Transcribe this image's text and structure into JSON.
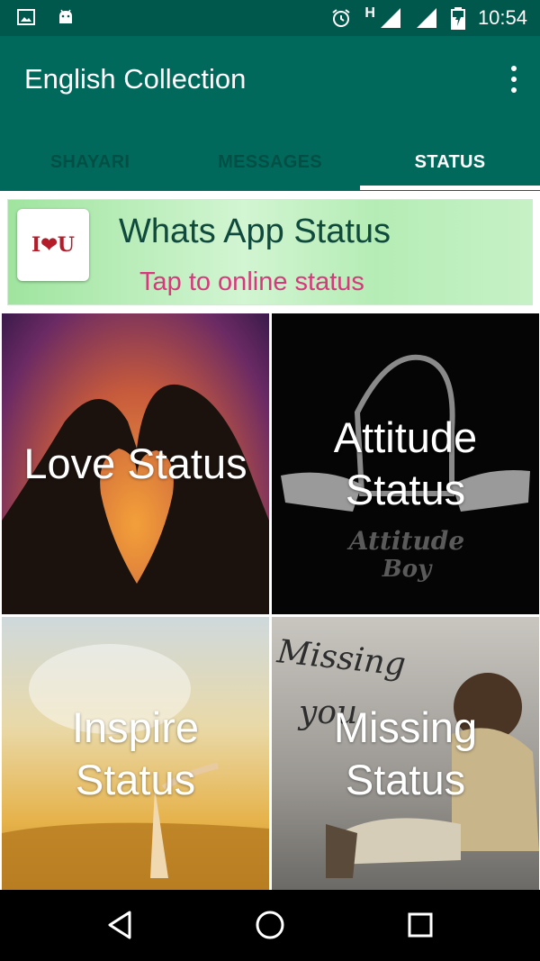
{
  "status_bar": {
    "time": "10:54",
    "network_letter": "H",
    "icons": [
      "gallery-icon",
      "android-icon",
      "alarm-icon",
      "signal-icon",
      "signal-icon",
      "battery-icon"
    ],
    "background_color": "#00574b"
  },
  "app_bar": {
    "title": "English Collection",
    "menu_icon": "more-vert-icon",
    "background_color": "#00695c"
  },
  "tabs": [
    {
      "label": "SHAYARI",
      "active": false
    },
    {
      "label": "MESSAGES",
      "active": false
    },
    {
      "label": "STATUS",
      "active": true
    }
  ],
  "banner": {
    "logo_text": "I❤U",
    "title": "Whats App Status",
    "subtitle": "Tap to online status"
  },
  "tiles": [
    {
      "label_line1": "Love Status",
      "label_line2": ""
    },
    {
      "label_line1": "Attitude",
      "label_line2": "Status",
      "image_text_1": "Attitude",
      "image_text_2": "Boy"
    },
    {
      "label_line1": "Inspire",
      "label_line2": "Status"
    },
    {
      "label_line1": "Missing",
      "label_line2": "Status",
      "image_text_1": "Missing",
      "image_text_2": "you"
    }
  ],
  "nav_bar": {
    "buttons": [
      "back-icon",
      "home-icon",
      "recents-icon"
    ]
  }
}
